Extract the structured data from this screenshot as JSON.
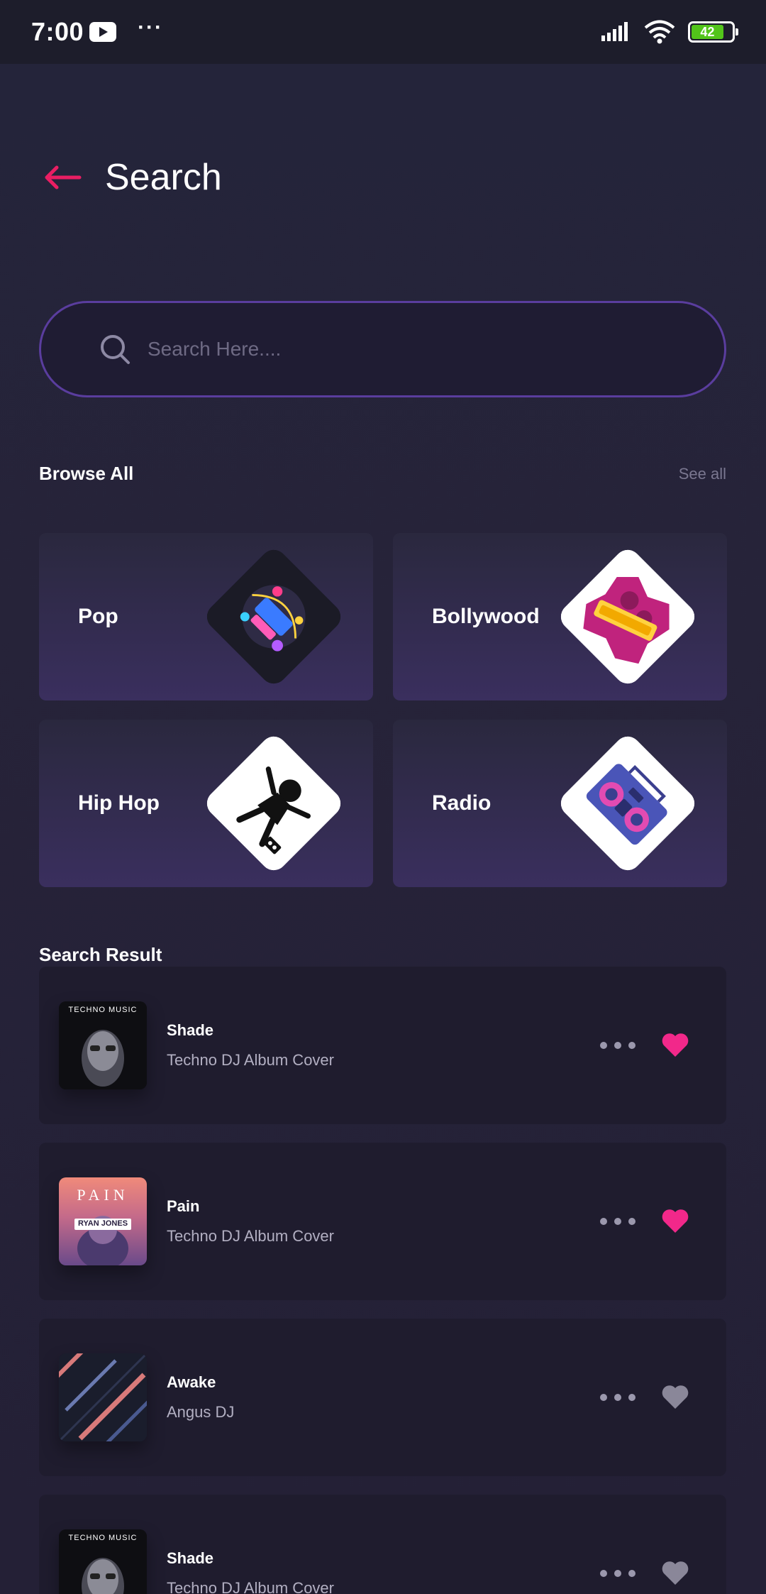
{
  "status": {
    "time": "7:00",
    "battery": "42"
  },
  "header": {
    "title": "Search"
  },
  "search": {
    "placeholder": "Search Here...."
  },
  "browse": {
    "title": "Browse All",
    "see_all": "See all",
    "categories": [
      {
        "label": "Pop"
      },
      {
        "label": "Bollywood"
      },
      {
        "label": "Hip Hop"
      },
      {
        "label": "Radio"
      }
    ]
  },
  "results": {
    "title": "Search Result",
    "items": [
      {
        "title": "Shade",
        "subtitle": "Techno DJ Album Cover",
        "cover_text": "TECHNO MUSIC",
        "liked": true
      },
      {
        "title": "Pain",
        "subtitle": "Techno DJ Album Cover",
        "cover_text": "PAIN",
        "cover_sub": "RYAN JONES",
        "liked": true
      },
      {
        "title": "Awake",
        "subtitle": "Angus DJ",
        "liked": false
      },
      {
        "title": "Shade",
        "subtitle": "Techno DJ Album Cover",
        "cover_text": "TECHNO MUSIC",
        "liked": false
      }
    ]
  },
  "colors": {
    "accent": "#e91e63",
    "heart_liked": "#f2288a",
    "heart_unliked": "#8a8799",
    "search_border": "#5a3d9e"
  },
  "icons": {
    "back": "arrow-left-icon",
    "search": "search-icon",
    "more": "more-dots-icon",
    "like": "heart-icon"
  }
}
